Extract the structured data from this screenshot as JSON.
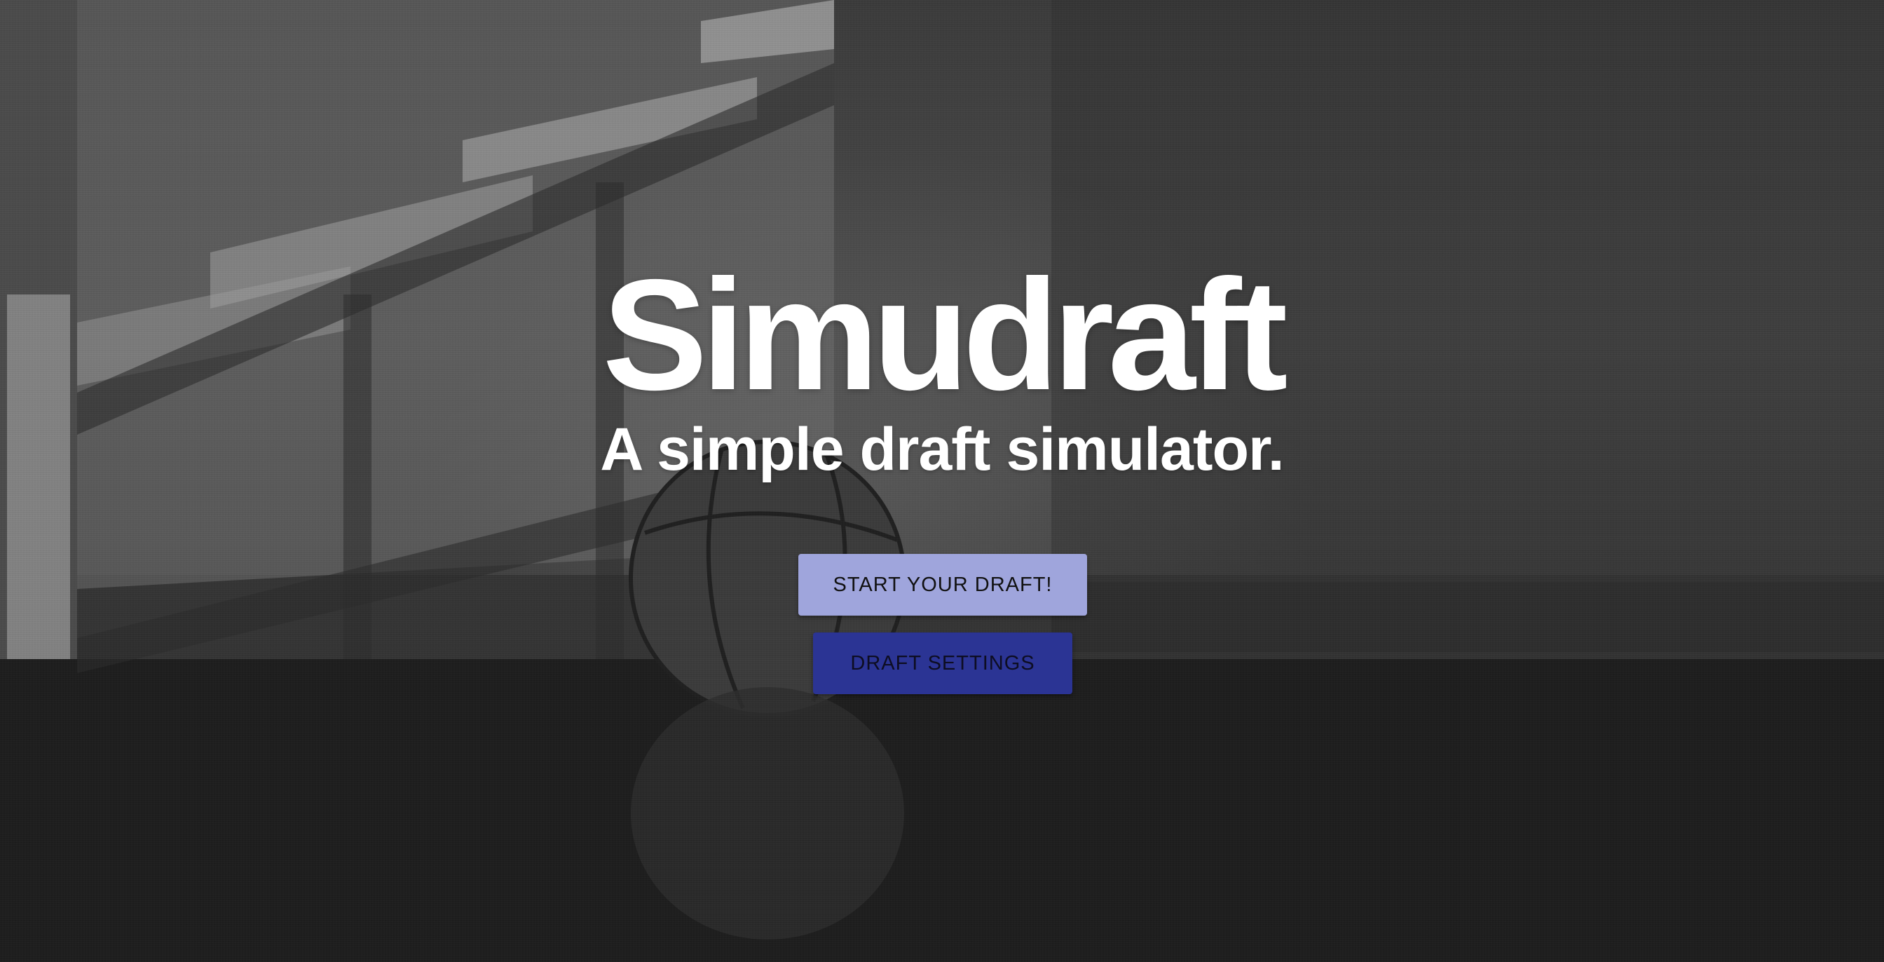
{
  "hero": {
    "title": "Simudraft",
    "subtitle": "A simple draft simulator."
  },
  "actions": {
    "start_label": "START YOUR DRAFT!",
    "settings_label": "DRAFT SETTINGS"
  },
  "colors": {
    "start_button_bg": "#9fa5dc",
    "settings_button_bg": "#2b3494",
    "title_text": "#ffffff"
  }
}
